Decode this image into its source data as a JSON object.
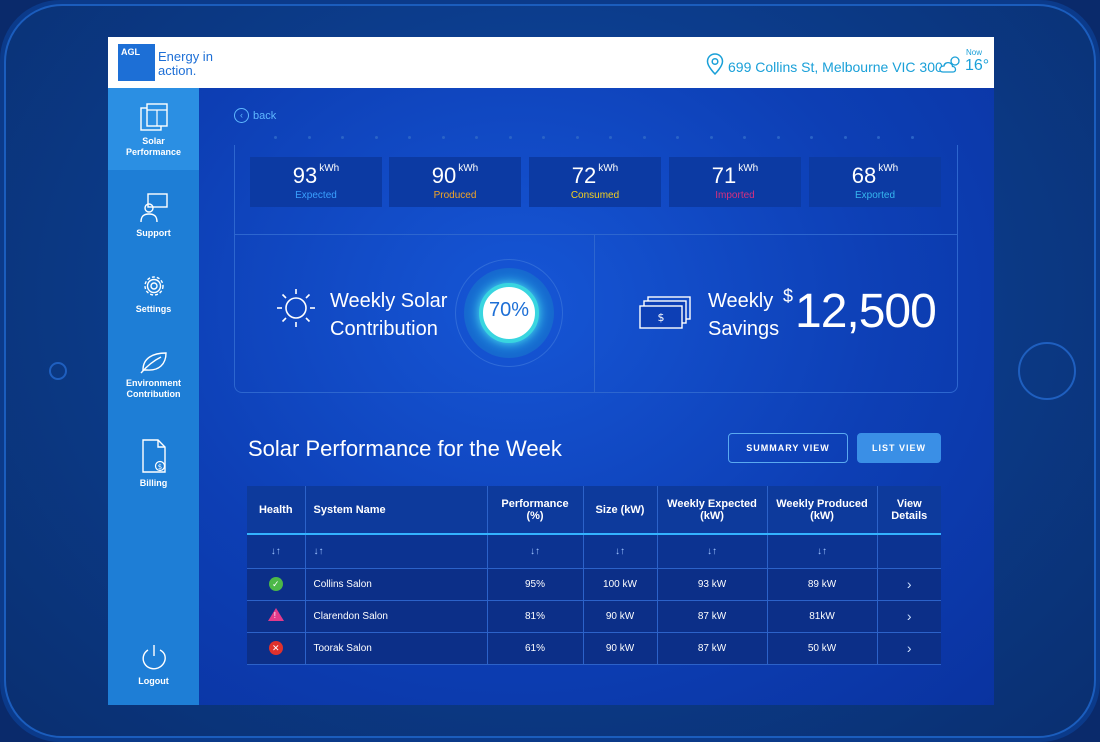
{
  "header": {
    "logo_brand": "AGL",
    "logo_line1": "Energy in",
    "logo_line2": "action.",
    "address": "699 Collins St, Melbourne VIC 3000",
    "weather_now": "Now",
    "weather_temp": "16°"
  },
  "sidebar": {
    "items": [
      {
        "label_line1": "Solar",
        "label_line2": "Performance",
        "icon": "solar-panel-icon"
      },
      {
        "label_line1": "Support",
        "label_line2": "",
        "icon": "support-chat-icon"
      },
      {
        "label_line1": "Settings",
        "label_line2": "",
        "icon": "gear-icon"
      },
      {
        "label_line1": "Environment",
        "label_line2": "Contribution",
        "icon": "leaf-icon"
      },
      {
        "label_line1": "Billing",
        "label_line2": "",
        "icon": "bill-icon"
      },
      {
        "label_line1": "Logout",
        "label_line2": "",
        "icon": "power-icon"
      }
    ]
  },
  "back_label": "back",
  "stats": [
    {
      "value": "93",
      "unit": "kWh",
      "label": "Expected",
      "color": "#3aa0ff"
    },
    {
      "value": "90",
      "unit": "kWh",
      "label": "Produced",
      "color": "#f5a623"
    },
    {
      "value": "72",
      "unit": "kWh",
      "label": "Consumed",
      "color": "#f7d21c"
    },
    {
      "value": "71",
      "unit": "kWh",
      "label": "Imported",
      "color": "#d6307f"
    },
    {
      "value": "68",
      "unit": "kWh",
      "label": "Exported",
      "color": "#36b7f0"
    }
  ],
  "contribution": {
    "line1": "Weekly Solar",
    "line2": "Contribution",
    "percent_label": "70%",
    "percent": 70
  },
  "savings": {
    "line1": "Weekly",
    "line2": "Savings",
    "currency": "$",
    "amount": "12,500"
  },
  "section": {
    "title": "Solar Performance for the Week",
    "summary_button": "SUMMARY VIEW",
    "list_button": "LIST VIEW"
  },
  "table": {
    "headers": {
      "health": "Health",
      "name": "System Name",
      "perf_line1": "Performance",
      "perf_line2": "(%)",
      "size": "Size (kW)",
      "expected_line1": "Weekly Expected",
      "expected_line2": "(kW)",
      "produced_line1": "Weekly Produced",
      "produced_line2": "(kW)",
      "view_line1": "View",
      "view_line2": "Details"
    },
    "sort_glyph": "↓↑",
    "rows": [
      {
        "health": "ok",
        "name": "Collins Salon",
        "performance": "95%",
        "size": "100 kW",
        "expected": "93 kW",
        "produced": "89 kW"
      },
      {
        "health": "warning",
        "name": "Clarendon Salon",
        "performance": "81%",
        "size": "90 kW",
        "expected": "87 kW",
        "produced": "81kW"
      },
      {
        "health": "error",
        "name": "Toorak Salon",
        "performance": "61%",
        "size": "90 kW",
        "expected": "87 kW",
        "produced": "50 kW"
      }
    ],
    "chevron": "›"
  }
}
